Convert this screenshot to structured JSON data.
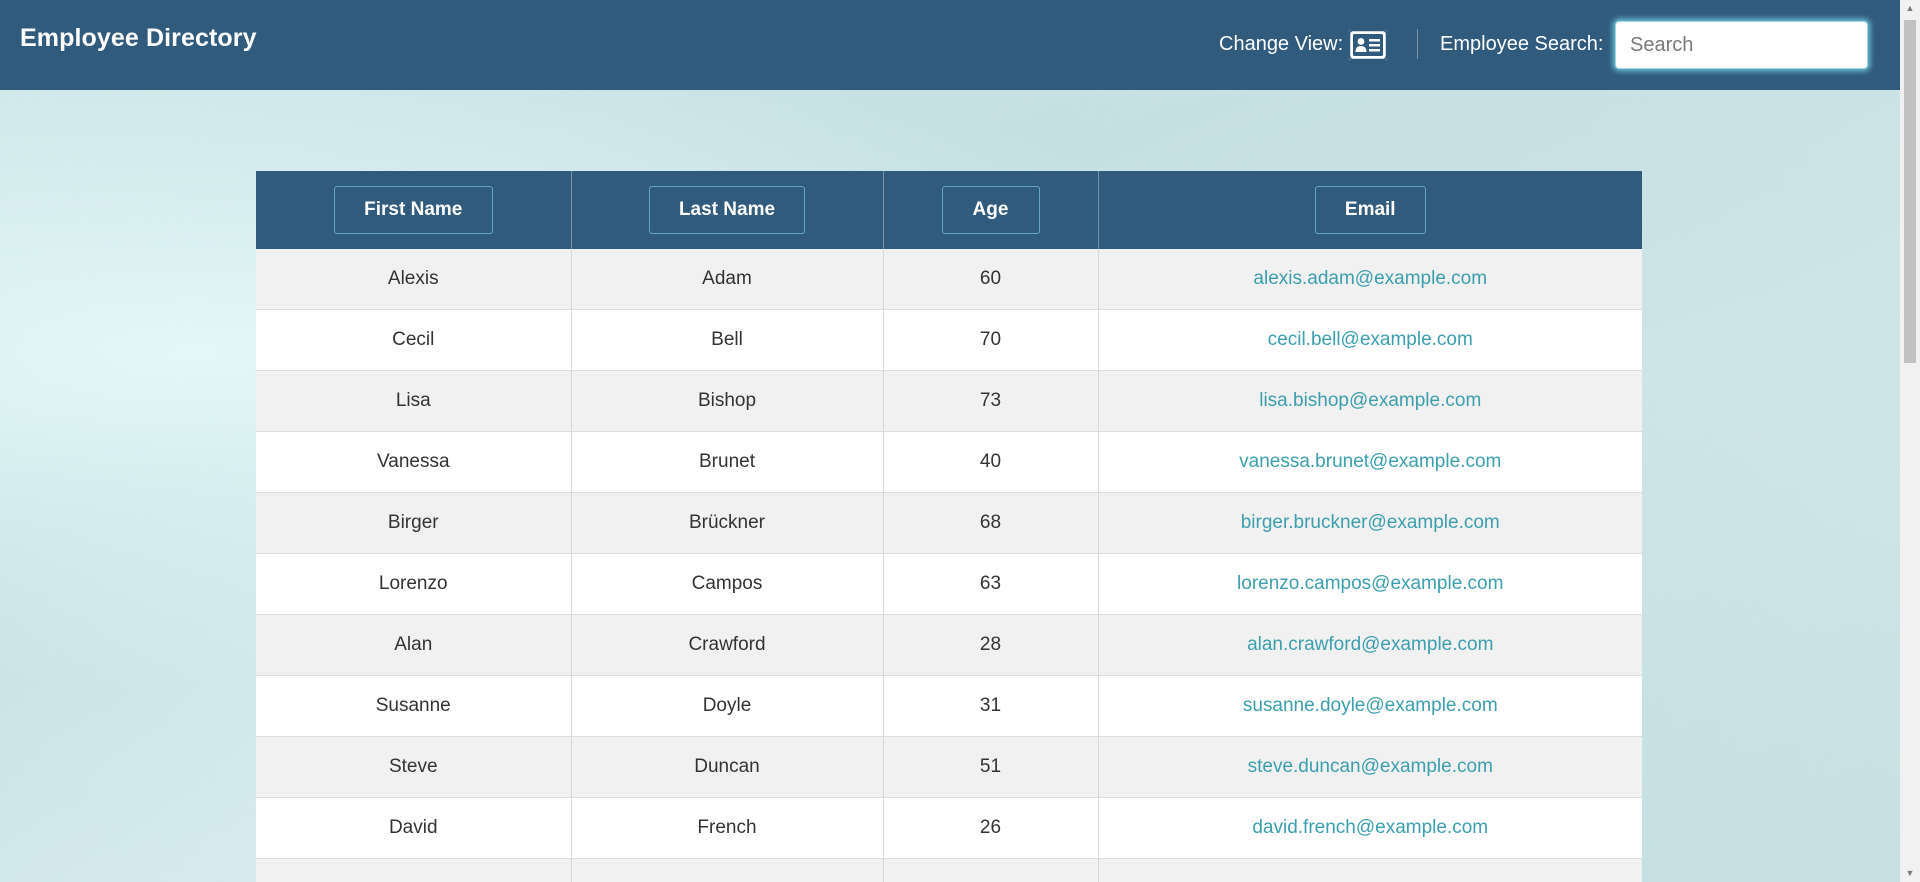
{
  "header": {
    "title": "Employee Directory",
    "change_view_label": "Change View:",
    "change_view_icon": "id-card-icon",
    "search_label": "Employee Search:",
    "search_placeholder": "Search",
    "search_value": ""
  },
  "table": {
    "columns": [
      "First Name",
      "Last Name",
      "Age",
      "Email"
    ],
    "rows": [
      [
        "Alexis",
        "Adam",
        "60",
        "alexis.adam@example.com"
      ],
      [
        "Cecil",
        "Bell",
        "70",
        "cecil.bell@example.com"
      ],
      [
        "Lisa",
        "Bishop",
        "73",
        "lisa.bishop@example.com"
      ],
      [
        "Vanessa",
        "Brunet",
        "40",
        "vanessa.brunet@example.com"
      ],
      [
        "Birger",
        "Brückner",
        "68",
        "birger.bruckner@example.com"
      ],
      [
        "Lorenzo",
        "Campos",
        "63",
        "lorenzo.campos@example.com"
      ],
      [
        "Alan",
        "Crawford",
        "28",
        "alan.crawford@example.com"
      ],
      [
        "Susanne",
        "Doyle",
        "31",
        "susanne.doyle@example.com"
      ],
      [
        "Steve",
        "Duncan",
        "51",
        "steve.duncan@example.com"
      ],
      [
        "David",
        "French",
        "26",
        "david.french@example.com"
      ],
      [
        "",
        "",
        "",
        ""
      ]
    ]
  },
  "colors": {
    "navbar": "#315b7d",
    "link": "#3b9fae",
    "row_odd": "#f1f1f1",
    "row_even": "#ffffff"
  }
}
